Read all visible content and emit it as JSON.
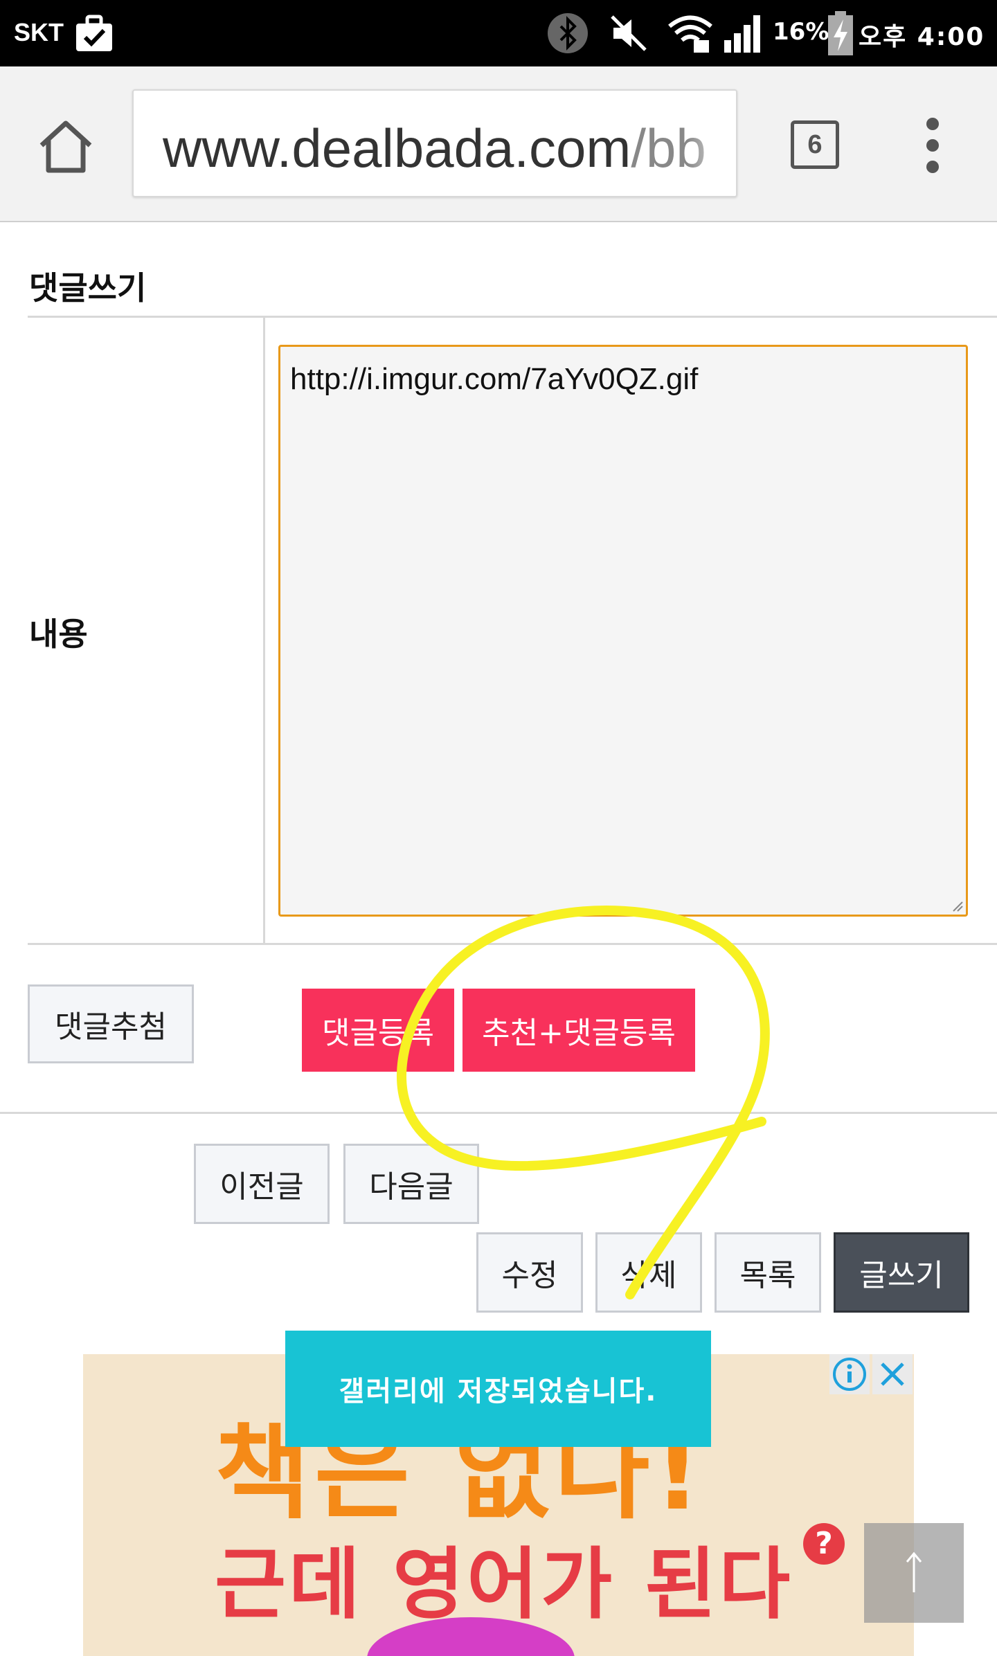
{
  "status_bar": {
    "carrier": "SKT",
    "battery_percent": "16%",
    "time": "오후 4:00",
    "icons": [
      "briefcase-check-icon",
      "bluetooth-icon",
      "mute-icon",
      "wifi-lock-icon",
      "signal-icon",
      "battery-charging-icon"
    ]
  },
  "browser": {
    "url_host": "www.dealbada.com",
    "url_path": "/bb",
    "tab_count": "6"
  },
  "comment_form": {
    "title": "댓글쓰기",
    "content_label": "내용",
    "content_value": "http://i.imgur.com/7aYv0QZ.gif"
  },
  "buttons": {
    "comment_recommend": "댓글추첨",
    "submit_comment": "댓글등록",
    "recommend_and_comment": "추천+댓글등록",
    "prev_post": "이전글",
    "next_post": "다음글",
    "edit": "수정",
    "delete": "삭제",
    "list": "목록",
    "write": "글쓰기"
  },
  "toast": {
    "message": "갤러리에 저장되었습니다."
  },
  "ad": {
    "headline": "책은 없다!",
    "subline": "근데 영어가 된다"
  },
  "colors": {
    "accent_pink": "#f8315b",
    "textarea_border": "#e8991a",
    "toast_bg": "#18c3d4",
    "annotation_yellow": "#f7f123"
  }
}
